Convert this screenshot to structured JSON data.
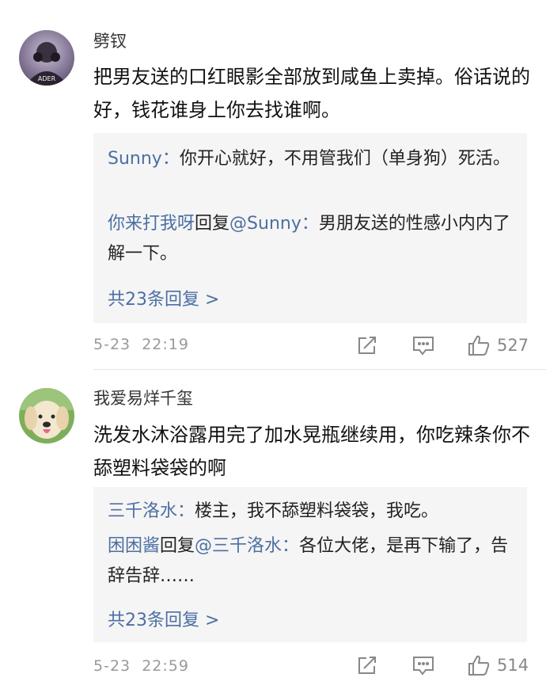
{
  "comments": [
    {
      "username": "劈钗",
      "avatar_badge": "ADER",
      "text": "把男友送的口红眼影全部放到咸鱼上卖掉。俗话说的好，钱花谁身上你去找谁啊。",
      "replies": [
        {
          "author": "Sunny",
          "sep": "：",
          "text": "你开心就好，不用管我们（单身狗）死活。"
        },
        {
          "author": "你来打我呀",
          "reply_word": "回复",
          "target": "@Sunny",
          "sep": "：",
          "text": "男朋友送的性感小内内了解一下。"
        }
      ],
      "more": "共23条回复 >",
      "date": "5-23",
      "time": "22:19",
      "likes": "527"
    },
    {
      "username": "我爱易烊千玺",
      "text": "洗发水沐浴露用完了加水晃瓶继续用，你吃辣条你不舔塑料袋袋的啊",
      "replies": [
        {
          "author": "三千洛水",
          "sep": "：",
          "text": "楼主，我不舔塑料袋袋，我吃。"
        },
        {
          "author": "困困酱",
          "reply_word": "回复",
          "target": "@三千洛水",
          "sep": "：",
          "text": "各位大佬，是再下输了，告辞告辞……"
        }
      ],
      "more": "共23条回复 >",
      "date": "5-23",
      "time": "22:59",
      "likes": "514"
    }
  ],
  "icons": [
    "share-icon",
    "comment-icon",
    "like-icon"
  ],
  "colors": {
    "link": "#4c6fa3",
    "reply_bg": "#f5f5f5",
    "meta": "#999999"
  }
}
